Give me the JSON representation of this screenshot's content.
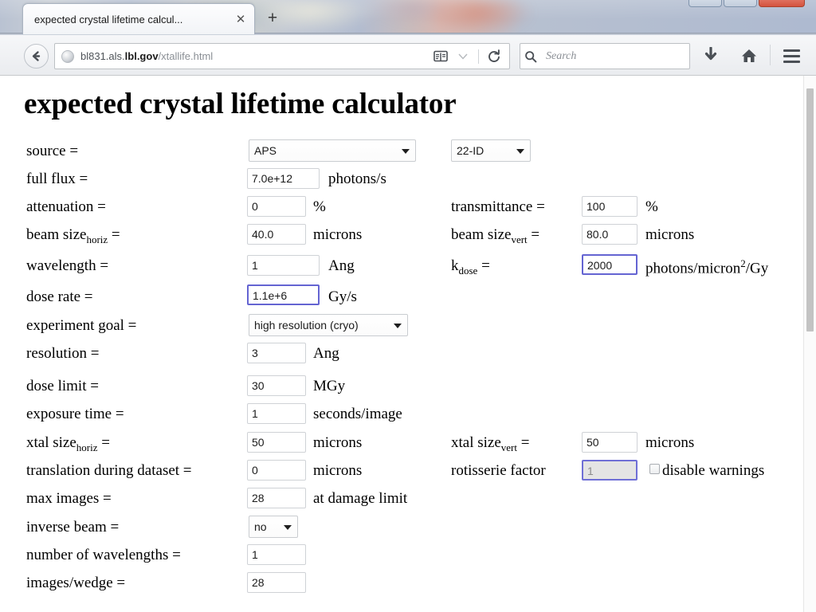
{
  "browser": {
    "tab": {
      "title": "expected crystal lifetime calcul...",
      "close_label": "✕",
      "new_tab_label": "+"
    },
    "toolbar": {
      "back_icon": "back-arrow-icon",
      "url_prefix": "bl831.als.",
      "url_domain": "lbl.gov",
      "url_path": "/xtallife.html",
      "reader_icon": "reader-mode-icon",
      "reader_dropdown_icon": "chevron-down-icon",
      "reload_icon": "reload-icon",
      "search_placeholder": "Search",
      "search_value": "",
      "search_icon": "search-icon",
      "download_icon": "download-arrow-icon",
      "home_icon": "home-icon",
      "menu_icon": "hamburger-menu-icon"
    },
    "window_controls": {
      "minimize_label": "",
      "maximize_label": "",
      "close_label": ""
    }
  },
  "page": {
    "title": "expected crystal lifetime calculator",
    "highlight_color": "#6464d2",
    "rows": [
      {
        "id": "source",
        "label": "source =",
        "control": "select",
        "value": "APS",
        "right_label": "",
        "right_control": "select",
        "right_value": "22-ID"
      },
      {
        "id": "full-flux",
        "label": "full flux =",
        "control": "text",
        "value": "7.0e+12",
        "unit": "photons/s"
      },
      {
        "id": "attenuation",
        "label": "attenuation =",
        "control": "text",
        "value": "0",
        "unit": "%",
        "right_label": "transmittance =",
        "right_value": "100",
        "right_unit": "%"
      },
      {
        "id": "beam-size-horiz",
        "label": "beam size",
        "label_sub": "horiz",
        "label_tail": " =",
        "control": "text",
        "value": "40.0",
        "unit": "microns",
        "right_label": "beam size",
        "right_label_sub": "vert",
        "right_label_tail": " =",
        "right_value": "80.0",
        "right_unit": "microns"
      },
      {
        "id": "wavelength",
        "label": "wavelength =",
        "control": "text",
        "value": "1",
        "unit": "Ang",
        "right_label": "k",
        "right_label_sub": "dose",
        "right_label_tail": " =",
        "right_value": "2000",
        "right_unit_pre": "photons/micron",
        "right_unit_sup": "2",
        "right_unit_post": "/Gy",
        "right_highlight": true
      },
      {
        "id": "dose-rate",
        "label": "dose rate =",
        "control": "text",
        "value": "1.1e+6",
        "unit": "Gy/s",
        "highlight": true
      },
      {
        "id": "experiment-goal",
        "label": "experiment goal =",
        "control": "select",
        "value": "high resolution (cryo)"
      },
      {
        "id": "resolution",
        "label": "resolution =",
        "control": "text",
        "value": "3",
        "unit": "Ang"
      },
      {
        "id": "dose-limit",
        "label": "dose limit =",
        "control": "text",
        "value": "30",
        "unit": "MGy"
      },
      {
        "id": "exposure-time",
        "label": "exposure time =",
        "control": "text",
        "value": "1",
        "unit": "seconds/image"
      },
      {
        "id": "xtal-size-horiz",
        "label": "xtal size",
        "label_sub": "horiz",
        "label_tail": " =",
        "control": "text",
        "value": "50",
        "unit": "microns",
        "right_label": "xtal size",
        "right_label_sub": "vert",
        "right_label_tail": " =",
        "right_value": "50",
        "right_unit": "microns"
      },
      {
        "id": "translation-during-dataset",
        "label": "translation during dataset =",
        "control": "text",
        "value": "0",
        "unit": "microns",
        "right_label": "rotisserie factor",
        "right_value": "1",
        "right_disabled": true,
        "checkbox_label": "disable warnings",
        "checkbox_checked": false
      },
      {
        "id": "max-images",
        "label": "max images =",
        "control": "text",
        "value": "28",
        "unit": "at damage limit"
      },
      {
        "id": "inverse-beam",
        "label": "inverse beam =",
        "control": "select",
        "value": "no"
      },
      {
        "id": "number-of-wavelengths",
        "label": "number of wavelengths =",
        "control": "text",
        "value": "1"
      },
      {
        "id": "images-per-wedge",
        "label": "images/wedge =",
        "control": "text",
        "value": "28"
      }
    ]
  }
}
